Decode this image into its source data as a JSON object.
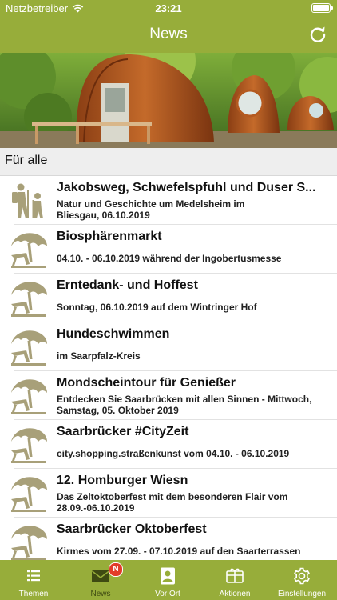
{
  "status_bar": {
    "carrier": "Netzbetreiber",
    "time": "23:21"
  },
  "header": {
    "title": "News"
  },
  "section": {
    "label": "Für alle"
  },
  "items": [
    {
      "title": "Jakobsweg, Schwefelspfuhl und Duser S...",
      "subtitle_1": "Natur und Geschichte um Medelsheim im",
      "subtitle_2": "Bliesgau, 06.10.2019",
      "icon": "hikers-icon"
    },
    {
      "title": "Biosphärenmarkt",
      "subtitle_1": "04.10. - 06.10.2019 während der Ingobertusmesse",
      "icon": "beach-umbrella-icon"
    },
    {
      "title": "Erntedank- und Hoffest",
      "subtitle_1": "Sonntag, 06.10.2019 auf dem Wintringer Hof",
      "icon": "beach-umbrella-icon"
    },
    {
      "title": "Hundeschwimmen",
      "subtitle_1": "im Saarpfalz-Kreis",
      "icon": "beach-umbrella-icon"
    },
    {
      "title": "Mondscheintour für Genießer",
      "subtitle_1": "Entdecken Sie Saarbrücken mit allen Sinnen - Mittwoch,",
      "subtitle_2": "Samstag, 05. Oktober 2019",
      "icon": "beach-umbrella-icon"
    },
    {
      "title": "Saarbrücker #CityZeit",
      "subtitle_1": "city.shopping.straßenkunst vom 04.10. - 06.10.2019",
      "icon": "beach-umbrella-icon"
    },
    {
      "title": "12. Homburger Wiesn",
      "subtitle_1": "Das Zeltoktoberfest mit dem besonderen Flair vom",
      "subtitle_2": "28.09.-06.10.2019",
      "icon": "beach-umbrella-icon"
    },
    {
      "title": "Saarbrücker Oktoberfest",
      "subtitle_1": "Kirmes vom  27.09. - 07.10.2019 auf den Saarterrassen",
      "icon": "beach-umbrella-icon"
    }
  ],
  "tabs": [
    {
      "label": "Themen",
      "icon": "list-icon"
    },
    {
      "label": "News",
      "icon": "mail-icon",
      "badge": "N",
      "active": true
    },
    {
      "label": "Vor Ort",
      "icon": "location-card-icon"
    },
    {
      "label": "Aktionen",
      "icon": "gift-card-icon"
    },
    {
      "label": "Einstellungen",
      "icon": "gear-icon"
    }
  ],
  "colors": {
    "brand": "#97ad3a",
    "badge": "#e23b2a",
    "icon": "#a8a079",
    "active_tab_text": "#3e4a12"
  }
}
